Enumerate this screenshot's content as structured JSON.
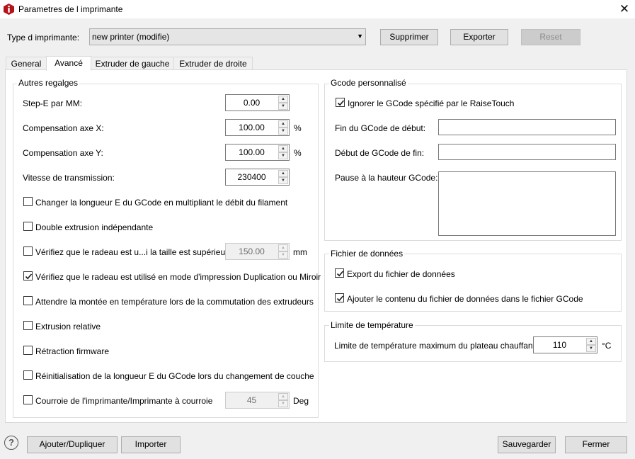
{
  "window": {
    "title": "Parametres de l imprimante",
    "close_glyph": "✕"
  },
  "printer_type": {
    "label": "Type d imprimante:",
    "value": "new printer (modifie)",
    "dropdown_arrow": "▼"
  },
  "toolbar": {
    "delete_label": "Supprimer",
    "export_label": "Exporter",
    "reset_label": "Reset"
  },
  "tabs": [
    {
      "label": "General"
    },
    {
      "label": "Avancé"
    },
    {
      "label": "Extruder de gauche"
    },
    {
      "label": "Extruder de droite"
    }
  ],
  "other_settings": {
    "title": "Autres regalges",
    "step_e": {
      "label": "Step-E par MM:",
      "value": "0.00"
    },
    "comp_x": {
      "label": "Compensation axe X:",
      "value": "100.00",
      "unit": "%"
    },
    "comp_y": {
      "label": "Compensation axe Y:",
      "value": "100.00",
      "unit": "%"
    },
    "baud": {
      "label": "Vitesse de transmission:",
      "value": "230400"
    },
    "checks": [
      {
        "label": "Changer la longueur E du GCode en multipliant le débit du filament",
        "checked": false
      },
      {
        "label": "Double extrusion indépendante",
        "checked": false
      },
      {
        "label": "Vérifiez que le radeau est u...i la taille est supérieure à",
        "checked": false
      },
      {
        "label": "Vérifiez que le radeau est utilisé en mode d'impression Duplication ou Miroir",
        "checked": true
      },
      {
        "label": "Attendre la montée en température lors de la commutation des extrudeurs",
        "checked": false
      },
      {
        "label": "Extrusion relative",
        "checked": false
      },
      {
        "label": "Rétraction firmware",
        "checked": false
      },
      {
        "label": "Réinitialisation de la longueur E du GCode lors du changement de couche",
        "checked": false
      },
      {
        "label": "Courroie de l'imprimante/Imprimante à courroie",
        "checked": false
      }
    ],
    "raft_size": {
      "value": "150.00",
      "unit": "mm"
    },
    "belt_angle": {
      "value": "45",
      "unit": "Deg"
    }
  },
  "custom_gcode": {
    "title": "Gcode personnalisé",
    "ignore": {
      "label": "Ignorer le GCode spécifié par le RaiseTouch",
      "checked": true
    },
    "start_end_label": "Fin du GCode de début:",
    "end_start_label": "Début de GCode de fin:",
    "pause_label": "Pause à la hauteur GCode:"
  },
  "data_file": {
    "title": "Fichier de données",
    "export": {
      "label": "Export du fichier de données",
      "checked": true
    },
    "append": {
      "label": "Ajouter le contenu du fichier de données dans le fichier GCode",
      "checked": true
    }
  },
  "temperature": {
    "title": "Limite de température",
    "bed_label": "Limite de température maximum du plateau chauffant:",
    "bed_value": "110",
    "unit": "°C"
  },
  "footer": {
    "help_glyph": "?",
    "add_label": "Ajouter/Dupliquer",
    "import_label": "Importer",
    "save_label": "Sauvegarder",
    "close_label": "Fermer"
  },
  "spin_glyphs": {
    "up": "▲",
    "down": "▼"
  },
  "colors": {
    "brand_icon": "#b3141c",
    "accent": "#1a1a1a",
    "panel": "#ffffff",
    "window_bg": "#f0f0f0"
  }
}
